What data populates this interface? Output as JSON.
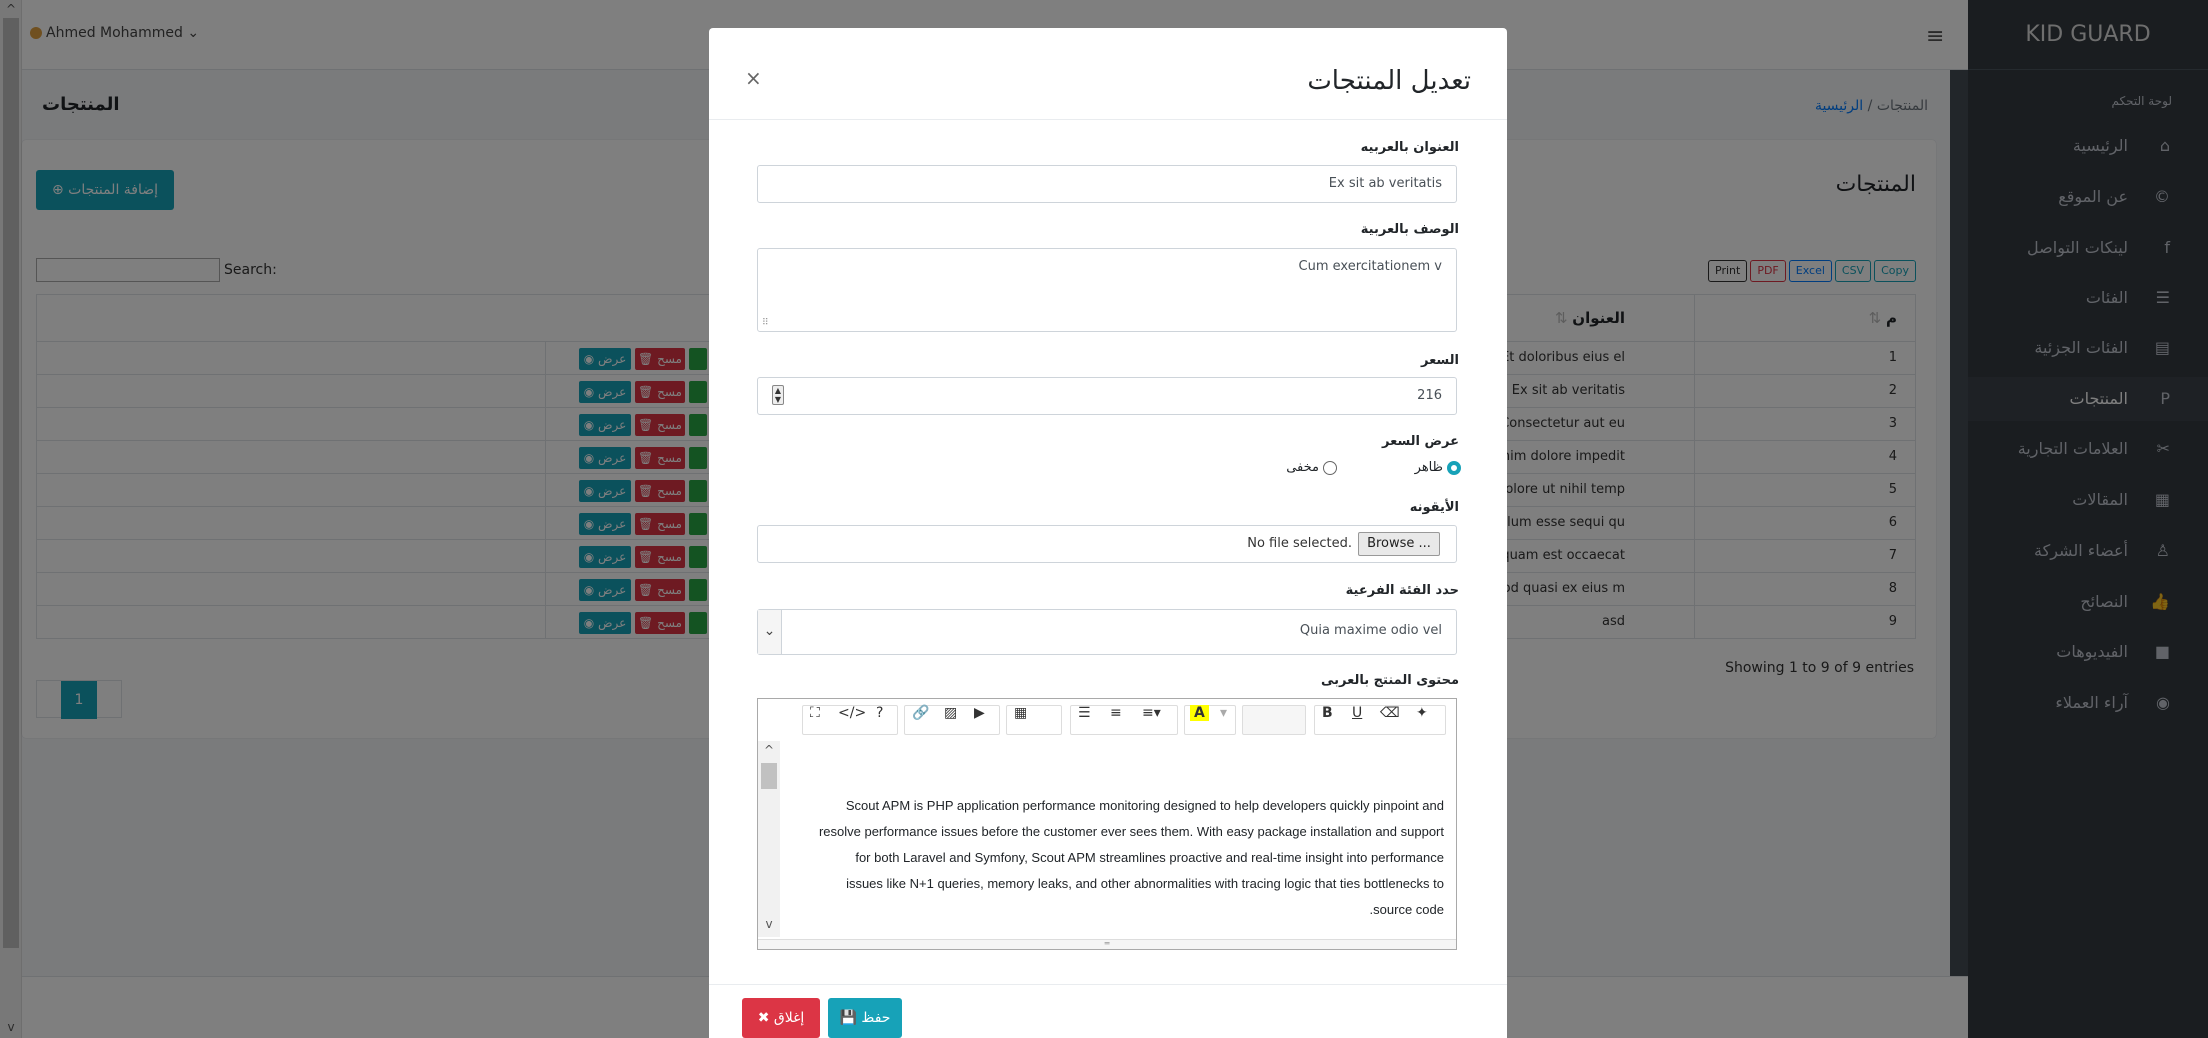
{
  "user": {
    "name": "Ahmed Mohammed"
  },
  "brand": "KID GUARD",
  "sidebar": {
    "header": "لوحة التحكم",
    "items": [
      {
        "label": "الرئيسية",
        "icon": "home-icon",
        "glyph": "⌂"
      },
      {
        "label": "عن الموقع",
        "icon": "copyright-icon",
        "glyph": "©"
      },
      {
        "label": "لينكات التواصل",
        "icon": "facebook-icon",
        "glyph": "f"
      },
      {
        "label": "الفئات",
        "icon": "list-icon",
        "glyph": "☰"
      },
      {
        "label": "الفئات الجزئية",
        "icon": "list-alt-icon",
        "glyph": "▤"
      },
      {
        "label": "المنتجات",
        "icon": "product-icon",
        "glyph": "P"
      },
      {
        "label": "العلامات التجارية",
        "icon": "brands-icon",
        "glyph": "✂"
      },
      {
        "label": "المقالات",
        "icon": "newspaper-icon",
        "glyph": "▦"
      },
      {
        "label": "أعضاء الشركة",
        "icon": "user-icon",
        "glyph": "♙"
      },
      {
        "label": "النصائح",
        "icon": "thumbs-up-icon",
        "glyph": "👍"
      },
      {
        "label": "الفيديوهات",
        "icon": "video-icon",
        "glyph": "■"
      },
      {
        "label": "آراء العملاء",
        "icon": "user-circle-icon",
        "glyph": "◉"
      }
    ]
  },
  "content": {
    "page_title": "المنتجات",
    "breadcrumb_home": "الرئيسية",
    "breadcrumb_sep": "/",
    "breadcrumb_current": "المنتجات",
    "card_title": "المنتجات",
    "add_button": "⊕ إضافة المنتجات",
    "search_label": "Search:",
    "export_buttons": [
      "Copy",
      "CSV",
      "Excel",
      "PDF",
      "Print"
    ],
    "columns": {
      "num": "م",
      "title": "العنوان"
    },
    "rows": [
      {
        "num": "1",
        "title": "Et doloribus eius el"
      },
      {
        "num": "2",
        "title": "Ex sit ab veritatis"
      },
      {
        "num": "3",
        "title": "Consectetur aut eu"
      },
      {
        "num": "4",
        "title": "Minim dolore impedit"
      },
      {
        "num": "5",
        "title": "Dolore ut nihil temp"
      },
      {
        "num": "6",
        "title": "Cillum esse sequi qu"
      },
      {
        "num": "7",
        "title": "Aliquam est occaecat"
      },
      {
        "num": "8",
        "title": "Quod quasi ex eius m"
      },
      {
        "num": "9",
        "title": "asd"
      }
    ],
    "actions": {
      "view": "◉ عرض",
      "delete": "🗑 مسح",
      "edit": "✎"
    },
    "showing": "Showing 1 to 9 of 9 entries",
    "page": "1"
  },
  "modal": {
    "title": "تعديل المنتجات",
    "close": "×",
    "fields": {
      "title_ar_label": "العنوان بالعربيه",
      "title_ar_value": "Ex sit ab veritatis",
      "desc_ar_label": "الوصف بالعربية",
      "desc_ar_value": "Cum exercitationem v",
      "price_label": "السعر",
      "price_value": "216",
      "show_price_label": "عرض السعر",
      "show_price_visible": "ظاهر",
      "show_price_hidden": "مخفى",
      "icon_label": "الأيقونه",
      "browse": "Browse ...",
      "no_file": "No file selected.",
      "subcat_label": "حدد الفئة الفرعية",
      "subcat_value": "Quia maxime odio vel",
      "content_label": "محتوى المنتج بالعربى",
      "content_text": "Scout APM is PHP application performance monitoring designed to help developers quickly pinpoint and resolve performance issues before the customer ever sees them. With easy package installation and support for both Laravel and Symfony, Scout APM streamlines proactive and real-time insight into performance issues like N+1 queries, memory leaks, and other abnormalities with tracing logic that ties bottlenecks to source code."
    },
    "buttons": {
      "close": "✖ إغلاق",
      "save": "💾 حفظ"
    }
  },
  "colors": {
    "accent": "#17a2b8",
    "danger": "#dc3545",
    "success": "#28a745",
    "sidebar": "#343a40"
  }
}
